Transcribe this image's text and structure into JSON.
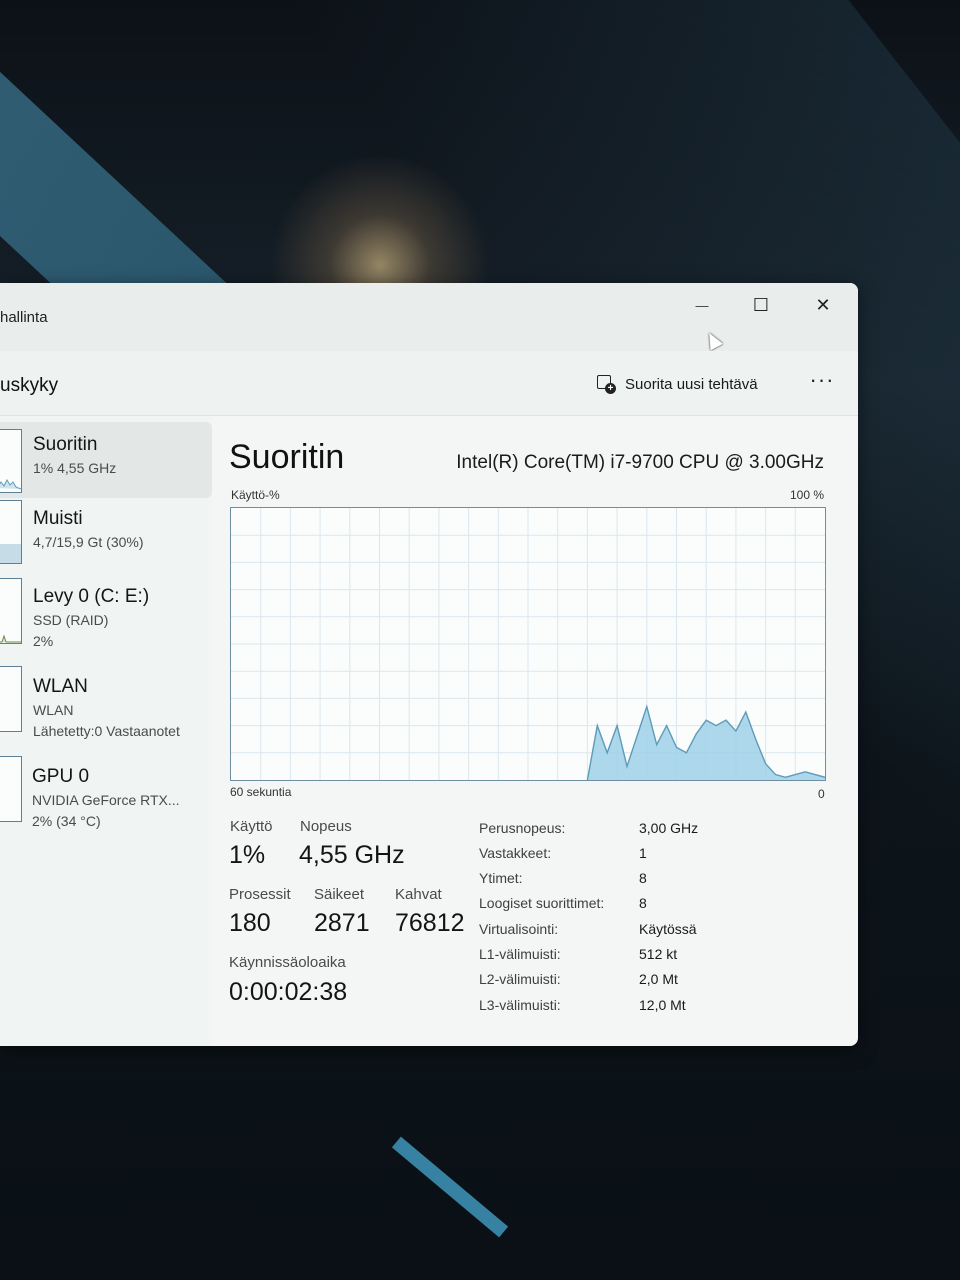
{
  "window": {
    "app_title": "hallinta",
    "minimize_glyph": "—",
    "maximize_glyph": "☐",
    "close_glyph": "✕"
  },
  "command_bar": {
    "page_title": "uskyky",
    "run_new_task_label": "Suorita uusi tehtävä",
    "run_new_task_icon": "run-task-icon",
    "more_glyph": "···"
  },
  "sidebar": {
    "items": [
      {
        "name": "Suoritin",
        "lines": [
          "1% 4,55 GHz"
        ],
        "selected": true,
        "thumb_fill": 0.15
      },
      {
        "name": "Muisti",
        "lines": [
          "4,7/15,9 Gt (30%)"
        ],
        "selected": false,
        "thumb_fill": 0.3
      },
      {
        "name": "Levy 0 (C: E:)",
        "lines": [
          "SSD (RAID)",
          "2%"
        ],
        "selected": false,
        "thumb_fill": 0.05
      },
      {
        "name": "WLAN",
        "lines": [
          "WLAN",
          "Lähetetty:0 Vastaanotet"
        ],
        "selected": false,
        "thumb_fill": 0.0
      },
      {
        "name": "GPU 0",
        "lines": [
          "NVIDIA GeForce RTX...",
          "2% (34 °C)"
        ],
        "selected": false,
        "thumb_fill": 0.0
      }
    ]
  },
  "cpu": {
    "heading": "Suoritin",
    "model": "Intel(R) Core(TM) i7-9700 CPU @ 3.00GHz",
    "graph_label_top_left": "Käyttö-%",
    "graph_label_top_right": "100 %",
    "graph_label_bottom_left": "60 sekuntia",
    "graph_label_bottom_right": "0",
    "stats": {
      "usage_label": "Käyttö",
      "usage_value": "1%",
      "speed_label": "Nopeus",
      "speed_value": "4,55 GHz",
      "processes_label": "Prosessit",
      "processes_value": "180",
      "threads_label": "Säikeet",
      "threads_value": "2871",
      "handles_label": "Kahvat",
      "handles_value": "76812",
      "uptime_label": "Käynnissäoloaika",
      "uptime_value": "0:00:02:38"
    },
    "specs": [
      {
        "label": "Perusnopeus:",
        "value": "3,00 GHz"
      },
      {
        "label": "Vastakkeet:",
        "value": "1"
      },
      {
        "label": "Ytimet:",
        "value": "8"
      },
      {
        "label": "Loogiset suorittimet:",
        "value": "8"
      },
      {
        "label": "Virtualisointi:",
        "value": "Käytössä"
      },
      {
        "label": "L1-välimuisti:",
        "value": "512 kt"
      },
      {
        "label": "L2-välimuisti:",
        "value": "2,0 Mt"
      },
      {
        "label": "L3-välimuisti:",
        "value": "12,0 Mt"
      }
    ]
  },
  "chart_data": {
    "type": "area",
    "xlabel": "60 sekuntia",
    "ylabel": "Käyttö-%",
    "x": [
      0,
      6,
      12,
      18,
      24,
      30,
      36,
      39,
      42,
      44,
      46,
      48,
      50,
      52,
      54,
      56,
      58,
      60
    ],
    "values": [
      0,
      0,
      0,
      0,
      0,
      0,
      0,
      0,
      0,
      0,
      0,
      0,
      0,
      0,
      0,
      0,
      0,
      0
    ],
    "tail_x": [
      36,
      37,
      38,
      39,
      40,
      42,
      43,
      44,
      45,
      46,
      47,
      48,
      49,
      50,
      51,
      52,
      53,
      54,
      55,
      56,
      57,
      58,
      59,
      60
    ],
    "tail_values": [
      0,
      20,
      10,
      20,
      5,
      27,
      13,
      20,
      12,
      10,
      17,
      22,
      20,
      22,
      18,
      25,
      15,
      6,
      2,
      1,
      2,
      3,
      2,
      1
    ],
    "xlim": [
      0,
      60
    ],
    "ylim": [
      0,
      100
    ],
    "grid": true,
    "series_color": "#9fd0e8",
    "line_color": "#5d9bb8"
  }
}
